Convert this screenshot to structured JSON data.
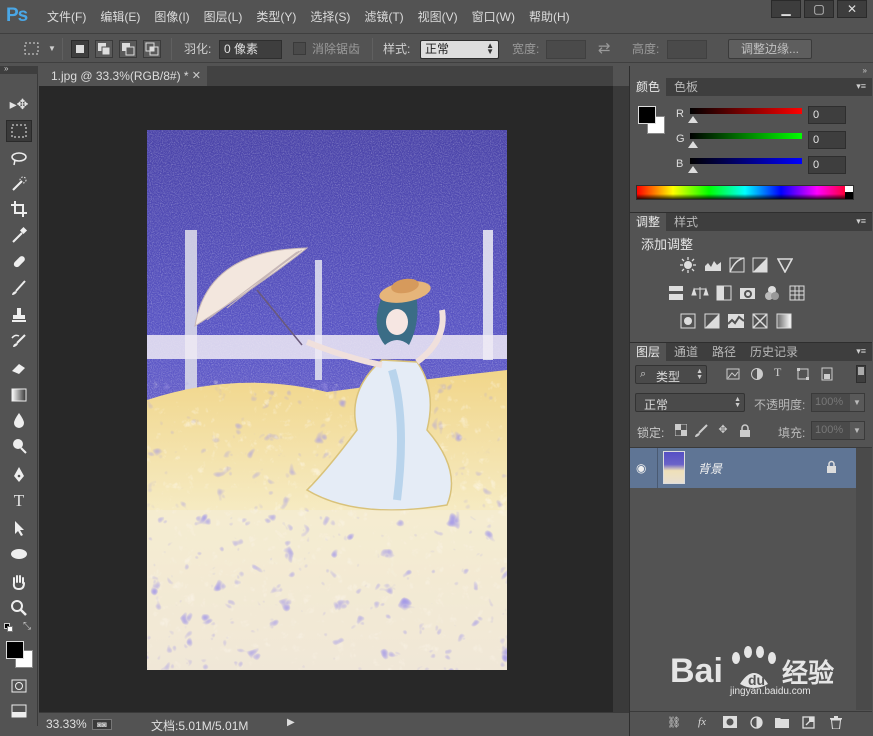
{
  "app": {
    "logo": "Ps",
    "menu": [
      "文件(F)",
      "编辑(E)",
      "图像(I)",
      "图层(L)",
      "类型(Y)",
      "选择(S)",
      "滤镜(T)",
      "视图(V)",
      "窗口(W)",
      "帮助(H)"
    ],
    "window_controls": [
      "minimize",
      "restore",
      "close"
    ]
  },
  "options": {
    "feather_label": "羽化:",
    "feather_value": "0 像素",
    "antialias_label": "消除锯齿",
    "style_label": "样式:",
    "style_value": "正常",
    "width_label": "宽度:",
    "height_label": "高度:",
    "refine_button": "调整边缘..."
  },
  "document": {
    "tab_title": "1.jpg @ 33.3%(RGB/8#) *",
    "zoom": "33.33%",
    "doc_size": "文档:5.01M/5.01M"
  },
  "color_panel": {
    "tabs": [
      "颜色",
      "色板"
    ],
    "channels": [
      {
        "label": "R",
        "value": "0",
        "color": "#ff2020"
      },
      {
        "label": "G",
        "value": "0",
        "color": "#20ff20"
      },
      {
        "label": "B",
        "value": "0",
        "color": "#2020ff"
      }
    ]
  },
  "adjustments_panel": {
    "tabs": [
      "调整",
      "样式"
    ],
    "title": "添加调整"
  },
  "layers_panel": {
    "tabs": [
      "图层",
      "通道",
      "路径",
      "历史记录"
    ],
    "filter_label": "类型",
    "blend_mode": "正常",
    "opacity_label": "不透明度:",
    "opacity_value": "100%",
    "lock_label": "锁定:",
    "fill_label": "填充:",
    "fill_value": "100%",
    "layers": [
      {
        "name": "背景",
        "visible": true,
        "locked": true,
        "selected": true
      }
    ]
  },
  "watermark": {
    "text": "Bai",
    "text2": "经验",
    "url": "jingyan.baidu.com"
  },
  "colors": {
    "ui_bg": "#535353",
    "canvas_bg": "#282828",
    "selected_layer": "#5f7595"
  }
}
